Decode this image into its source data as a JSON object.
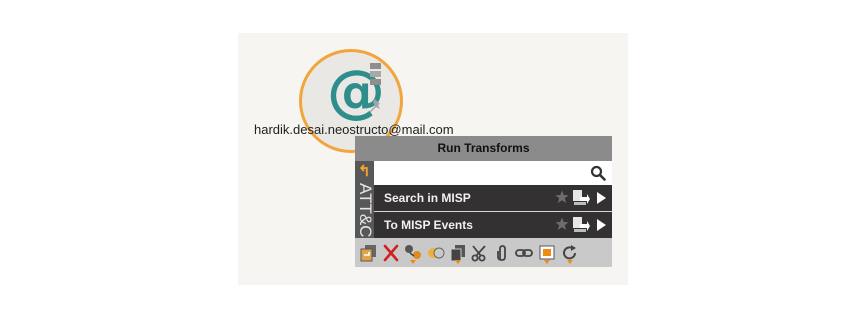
{
  "entity": {
    "label": "hardik.desai.neostructo@mail.com",
    "glyph": "@",
    "icon": "email-address-entity-icon",
    "accent_color": "#f0a63c",
    "glyph_color": "#2f8e8b"
  },
  "panel": {
    "title": "Run Transforms",
    "side_tab_label": "ATT&CK",
    "search": {
      "value": "",
      "placeholder": ""
    },
    "transforms": [
      {
        "label": "Search in MISP"
      },
      {
        "label": "To MISP Events"
      }
    ]
  },
  "toolbar": {
    "icons": [
      "collapse-icon",
      "delete-icon",
      "change-type-icon",
      "merge-icon",
      "copy-icon",
      "cut-icon",
      "attach-icon",
      "link-icon",
      "select-icon",
      "refresh-icon"
    ]
  }
}
